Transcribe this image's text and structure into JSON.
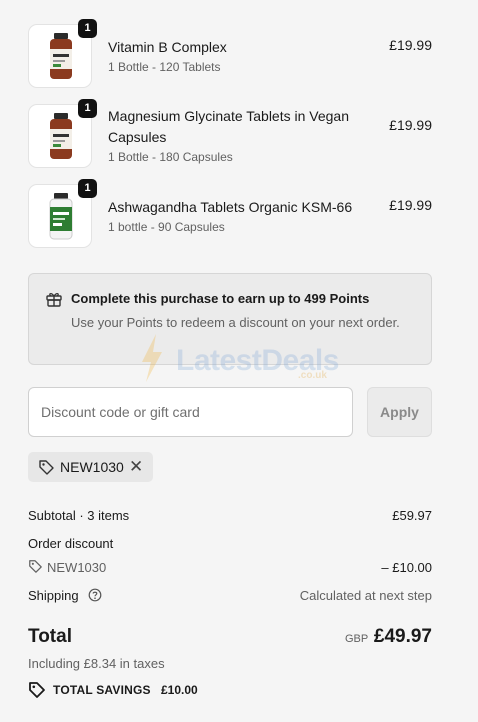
{
  "cart_items": [
    {
      "quantity": "1",
      "name": "Vitamin B Complex",
      "variant": "1 Bottle - 120 Tablets",
      "price": "£19.99",
      "bottle_label": "B COMPLEX"
    },
    {
      "quantity": "1",
      "name": "Magnesium Glycinate Tablets in Vegan Capsules",
      "variant": "1 Bottle - 180 Capsules",
      "price": "£19.99",
      "bottle_label": "GLYCINATE"
    },
    {
      "quantity": "1",
      "name": "Ashwagandha Tablets Organic KSM-66",
      "variant": "1 bottle - 90 Capsules",
      "price": "£19.99",
      "bottle_label": "ASHWAGANDHA"
    }
  ],
  "points": {
    "title": "Complete this purchase to earn up to 499 Points",
    "subtitle": "Use your Points to redeem a discount on your next order."
  },
  "watermark": {
    "text": "LatestDeals",
    "sub": ".co.uk"
  },
  "discount": {
    "placeholder": "Discount code or gift card",
    "apply_label": "Apply"
  },
  "applied_code": {
    "code": "NEW1030"
  },
  "summary": {
    "subtotal_label": "Subtotal · 3 items",
    "subtotal_value": "£59.97",
    "order_discount_label": "Order discount",
    "discount_code": "NEW1030",
    "discount_value": "– £10.00",
    "shipping_label": "Shipping",
    "shipping_value": "Calculated at next step",
    "total_label": "Total",
    "currency": "GBP",
    "total_value": "£49.97",
    "taxes": "Including £8.34 in taxes",
    "savings_label": "TOTAL SAVINGS",
    "savings_value": "£10.00"
  },
  "colors": {
    "background": "#f5f5f5",
    "badge": "#111111",
    "bottle_amber": "#8b3a1f",
    "bottle_green": "#2e7d32"
  },
  "icons": [
    "gift-icon",
    "tag-icon",
    "close-icon",
    "help-circle-icon",
    "savings-tag-icon"
  ]
}
